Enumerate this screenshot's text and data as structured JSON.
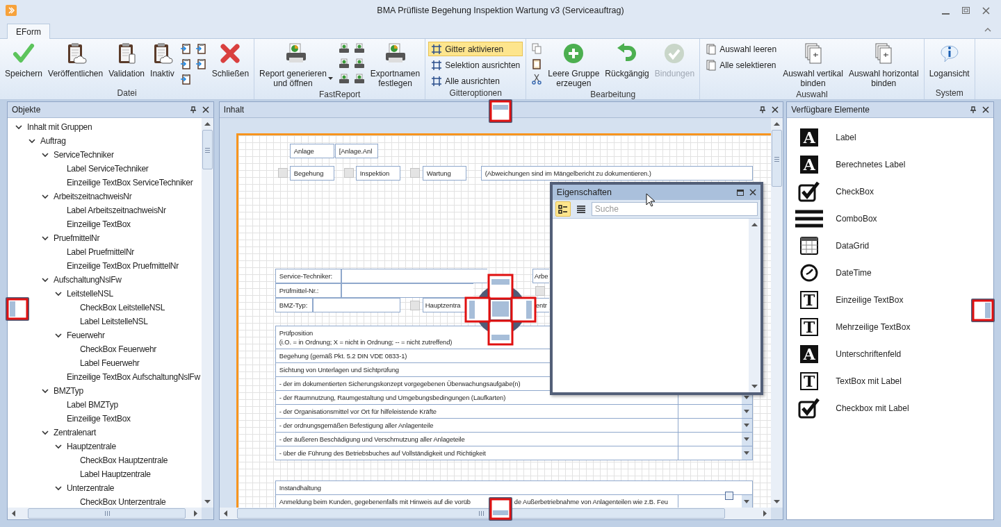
{
  "window": {
    "title": "BMA Prüfliste Begehung Inspektion Wartung v3 (Serviceauftrag)"
  },
  "ribbon": {
    "tabs": [
      {
        "label": "EForm",
        "selected": true
      }
    ],
    "groups": [
      {
        "label": "Datei",
        "items": [
          {
            "kind": "large",
            "label": "Speichern"
          },
          {
            "kind": "large",
            "label": "Veröffentlichen"
          },
          {
            "kind": "large",
            "label": "Validation"
          },
          {
            "kind": "large",
            "label": "Inaktiv"
          },
          {
            "kind": "icon_grid"
          },
          {
            "kind": "large",
            "label": "Schließen"
          }
        ]
      },
      {
        "label": "FastReport",
        "items": [
          {
            "kind": "large",
            "label": "Report generieren\nund öffnen",
            "dropdown": true
          },
          {
            "kind": "icon_grid"
          },
          {
            "kind": "large",
            "label": "Exportnamen\nfestlegen"
          }
        ]
      },
      {
        "label": "Gitteroptionen",
        "items": [
          {
            "kind": "small",
            "label": "Gitter aktivieren",
            "checked": true
          },
          {
            "kind": "small",
            "label": "Selektion ausrichten",
            "checked": false
          },
          {
            "kind": "small",
            "label": "Alle ausrichten",
            "checked": false
          }
        ]
      },
      {
        "label": "Bearbeitung",
        "items": [
          {
            "kind": "icon_grid"
          },
          {
            "kind": "large",
            "label": "Leere Gruppe\nerzeugen",
            "disabled": false
          },
          {
            "kind": "large",
            "label": "Rückgängig",
            "disabled": false
          },
          {
            "kind": "large",
            "label": "Bindungen",
            "disabled": true
          }
        ]
      },
      {
        "label": "Auswahl",
        "items": [
          {
            "kind": "small",
            "label": "Auswahl leeren"
          },
          {
            "kind": "small",
            "label": "Alle selektieren"
          },
          {
            "kind": "large",
            "label": "Auswahl vertikal\nbinden"
          },
          {
            "kind": "large",
            "label": "Auswahl horizontal\nbinden"
          }
        ]
      },
      {
        "label": "System",
        "items": [
          {
            "kind": "large",
            "label": "Logansicht"
          }
        ]
      }
    ]
  },
  "objects_panel": {
    "title": "Objekte",
    "tree": [
      {
        "label": "Inhalt mit Gruppen",
        "expanded": true,
        "children": [
          {
            "label": "Auftrag",
            "expanded": true,
            "children": [
              {
                "label": "ServiceTechniker",
                "expanded": true,
                "children": [
                  {
                    "label": "Label ServiceTechniker"
                  },
                  {
                    "label": "Einzeilige TextBox ServiceTechniker"
                  }
                ]
              },
              {
                "label": "ArbeitszeitnachweisNr",
                "expanded": true,
                "children": [
                  {
                    "label": "Label ArbeitszeitnachweisNr"
                  },
                  {
                    "label": "Einzeilige TextBox"
                  }
                ]
              },
              {
                "label": "PruefmittelNr",
                "expanded": true,
                "children": [
                  {
                    "label": "Label PruefmittelNr"
                  },
                  {
                    "label": "Einzeilige TextBox PruefmittelNr"
                  }
                ]
              },
              {
                "label": "AufschaltungNslFw",
                "expanded": true,
                "children": [
                  {
                    "label": "LeitstelleNSL",
                    "expanded": true,
                    "children": [
                      {
                        "label": "CheckBox LeitstelleNSL"
                      },
                      {
                        "label": "Label LeitstelleNSL"
                      }
                    ]
                  },
                  {
                    "label": "Feuerwehr",
                    "expanded": true,
                    "children": [
                      {
                        "label": "CheckBox Feuerwehr"
                      },
                      {
                        "label": "Label Feuerwehr"
                      }
                    ]
                  },
                  {
                    "label": "Einzeilige TextBox AufschaltungNslFw"
                  }
                ]
              },
              {
                "label": "BMZTyp",
                "expanded": true,
                "children": [
                  {
                    "label": "Label BMZTyp"
                  },
                  {
                    "label": "Einzeilige TextBox"
                  }
                ]
              },
              {
                "label": "Zentralenart",
                "expanded": true,
                "children": [
                  {
                    "label": "Hauptzentrale",
                    "expanded": true,
                    "children": [
                      {
                        "label": "CheckBox Hauptzentrale"
                      },
                      {
                        "label": "Label Hauptzentrale"
                      }
                    ]
                  },
                  {
                    "label": "Unterzentrale",
                    "expanded": true,
                    "children": [
                      {
                        "label": "CheckBox Unterzentrale"
                      }
                    ]
                  }
                ]
              }
            ]
          }
        ]
      }
    ]
  },
  "content_panel": {
    "title": "Inhalt",
    "form": [
      {
        "kind": "label",
        "text": "Anlage"
      },
      {
        "kind": "label",
        "text": "[Anlage.Anl"
      },
      {
        "kind": "checkbox",
        "checked": false
      },
      {
        "kind": "label",
        "text": "Begehung"
      },
      {
        "kind": "checkbox",
        "checked": false
      },
      {
        "kind": "label",
        "text": "Inspektion"
      },
      {
        "kind": "checkbox",
        "checked": false
      },
      {
        "kind": "label",
        "text": "Wartung"
      },
      {
        "kind": "label",
        "text": "(Abweichungen sind im Mängelbericht zu dokumentieren.)"
      },
      {
        "kind": "label",
        "text": "Service-Techniker:"
      },
      {
        "kind": "input"
      },
      {
        "kind": "label",
        "text": "Arbe"
      },
      {
        "kind": "label",
        "text": "Prüfmittel-Nr.:"
      },
      {
        "kind": "input"
      },
      {
        "kind": "checkbox",
        "checked": false
      },
      {
        "kind": "label",
        "text": "BMZ-Typ:"
      },
      {
        "kind": "input"
      },
      {
        "kind": "checkbox",
        "checked": false
      },
      {
        "kind": "label",
        "text": "Hauptzentra"
      },
      {
        "kind": "label",
        "text": "entr"
      }
    ],
    "tables": [
      {
        "header": [
          "Prüfposition",
          "(i.O. = in Ordnung; X = nicht in Ordnung; -- = nicht zutreffend)"
        ],
        "rows": [
          {
            "kind": "section",
            "text_parts": [
              "Begehung (gemäß Pkt. 5.2 DIN VDE 0833-1)"
            ]
          },
          {
            "kind": "section",
            "text_parts": [
              "Sichtung von Unterlagen und Sichtprüfung"
            ]
          },
          {
            "kind": "section",
            "text_parts": [
              "- der im dokumentierten Sicherungskonzept vorgegebenen Überwachungsaufgabe(n)"
            ]
          },
          {
            "kind": "check",
            "text_parts": [
              "- der Raumnutzung, Raumgestaltung und Umgebungsbedingungen (Laufkarten)"
            ]
          },
          {
            "kind": "check",
            "text_parts": [
              "- der Organisationsmittel vor Ort für hilfeleistende Kräfte"
            ]
          },
          {
            "kind": "check",
            "text_parts": [
              "- der ordnungsgemäßen Befestigung aller Anlagenteile"
            ]
          },
          {
            "kind": "check",
            "text_parts": [
              "- der äußeren Beschädigung und Verschmutzung aller Anlageteile"
            ]
          },
          {
            "kind": "check",
            "text_parts": [
              "- über die Führung des Betriebsbuches auf Vollständigkeit und Richtigkeit"
            ]
          }
        ]
      },
      {
        "header": [
          "Instandhaltung"
        ],
        "rows": [
          {
            "kind": "check",
            "text_parts": [
              "Anmeldung beim Kunden, gegebenenfalls mit Hinweis auf die vorüb",
              "de Außerbetriebnahme von Anlagenteilen wie z.B. Feu"
            ]
          }
        ]
      }
    ]
  },
  "properties_window": {
    "title": "Eigenschaften",
    "view_buttons": [
      {
        "selected": true
      },
      {
        "selected": false
      }
    ],
    "search": {
      "placeholder": "Suche"
    }
  },
  "elements_panel": {
    "title": "Verfügbare Elemente",
    "items": [
      {
        "kind": "letter",
        "glyph": "A",
        "label": "Label"
      },
      {
        "kind": "letter",
        "glyph": "A",
        "label": "Berechnetes Label"
      },
      {
        "kind": "checkbox",
        "label": "CheckBox"
      },
      {
        "kind": "combobox",
        "label": "ComboBox"
      },
      {
        "kind": "datagrid",
        "label": "DataGrid"
      },
      {
        "kind": "datetime",
        "label": "DateTime"
      },
      {
        "kind": "framed_letter",
        "glyph": "T",
        "label": "Einzeilige TextBox"
      },
      {
        "kind": "framed_letter",
        "glyph": "T",
        "label": "Mehrzeilige TextBox"
      },
      {
        "kind": "letter",
        "glyph": "A",
        "label": "Unterschriftenfeld"
      },
      {
        "kind": "framed_letter",
        "glyph": "T",
        "label": "TextBox mit Label"
      },
      {
        "kind": "checkbox",
        "label": "Checkbox mit Label"
      }
    ]
  }
}
